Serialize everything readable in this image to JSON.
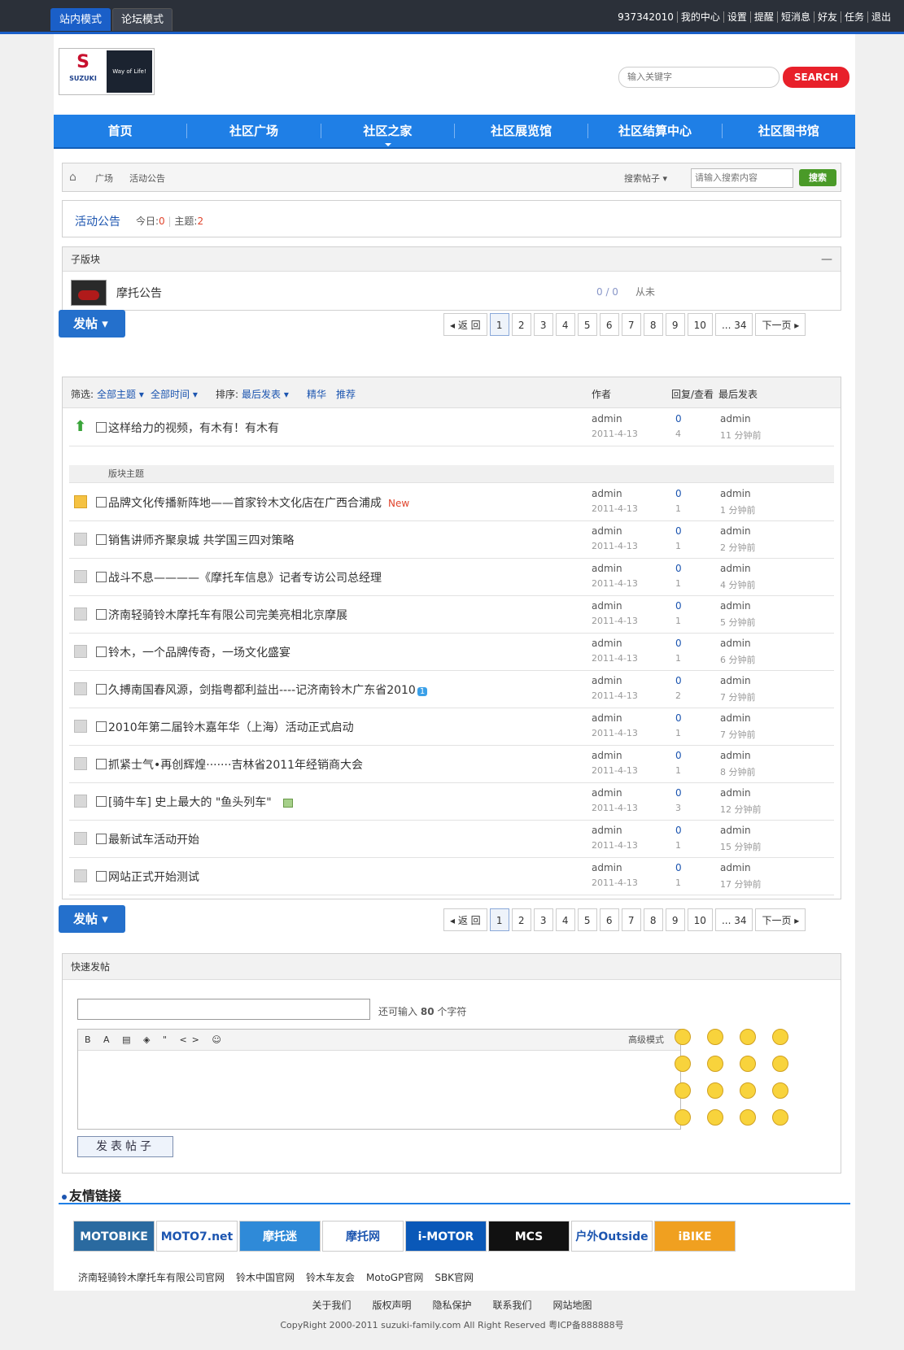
{
  "topbar": {
    "tabs": [
      "站内模式",
      "论坛模式"
    ],
    "links": [
      "937342010",
      "我的中心",
      "设置",
      "提醒",
      "短消息",
      "好友",
      "任务",
      "退出"
    ]
  },
  "header": {
    "logo_brand": "SUZUKI",
    "logo_slogan": "Way of Life!",
    "search_placeholder": "输入关键字",
    "search_button": "SEARCH"
  },
  "nav": [
    "首页",
    "社区广场",
    "社区之家",
    "社区展览馆",
    "社区结算中心",
    "社区图书馆"
  ],
  "breadcrumb": {
    "items": [
      "广场",
      "活动公告"
    ],
    "search_type": "搜索帖子 ▾",
    "search_placeholder": "请输入搜索内容",
    "search_button": "搜索"
  },
  "forum": {
    "name": "活动公告",
    "today_label": "今日:",
    "today": "0",
    "topics_label": "主题:",
    "topics": "2"
  },
  "subforum": {
    "header": "子版块",
    "collapse": "—",
    "name": "摩托公告",
    "counts": "0 / 0",
    "last": "从未"
  },
  "post_button": "发帖 ▾",
  "pager": [
    "◂ 返 回",
    "1",
    "2",
    "3",
    "4",
    "5",
    "6",
    "7",
    "8",
    "9",
    "10",
    "... 34",
    "下一页 ▸"
  ],
  "thread_header": {
    "filter_label": "筛选:",
    "filter_all": "全部主题 ▾",
    "filter_time": "全部时间 ▾",
    "sort_label": "排序:",
    "sort_value": "最后发表 ▾",
    "digest": "精华",
    "recommend": "推荐",
    "col_author": "作者",
    "col_reply": "回复/查看",
    "col_last": "最后发表"
  },
  "sticky": {
    "title": "这样给力的视频，有木有！有木有",
    "author": "admin",
    "date": "2011-4-13",
    "replies": "0",
    "views": "4",
    "last_user": "admin",
    "last_time": "11 分钟前"
  },
  "section_label": "版块主题",
  "threads": [
    {
      "title": "品牌文化传播新阵地——首家铃木文化店在广西合浦成",
      "new": "New",
      "author": "admin",
      "date": "2011-4-13",
      "replies": "0",
      "views": "1",
      "last_user": "admin",
      "last_time": "1 分钟前"
    },
    {
      "title": "销售讲师齐聚泉城  共学国三四对策略",
      "author": "admin",
      "date": "2011-4-13",
      "replies": "0",
      "views": "1",
      "last_user": "admin",
      "last_time": "2 分钟前"
    },
    {
      "title": "战斗不息————《摩托车信息》记者专访公司总经理",
      "author": "admin",
      "date": "2011-4-13",
      "replies": "0",
      "views": "1",
      "last_user": "admin",
      "last_time": "4 分钟前"
    },
    {
      "title": "济南轻骑铃木摩托车有限公司完美亮相北京摩展",
      "author": "admin",
      "date": "2011-4-13",
      "replies": "0",
      "views": "1",
      "last_user": "admin",
      "last_time": "5 分钟前"
    },
    {
      "title": "铃木，一个品牌传奇，一场文化盛宴",
      "author": "admin",
      "date": "2011-4-13",
      "replies": "0",
      "views": "1",
      "last_user": "admin",
      "last_time": "6 分钟前"
    },
    {
      "title": "久搏南国春风源，剑指粤都利益出----记济南铃木广东省2010",
      "tag": "1",
      "author": "admin",
      "date": "2011-4-13",
      "replies": "0",
      "views": "2",
      "last_user": "admin",
      "last_time": "7 分钟前"
    },
    {
      "title": "2010年第二届铃木嘉年华（上海）活动正式启动",
      "author": "admin",
      "date": "2011-4-13",
      "replies": "0",
      "views": "1",
      "last_user": "admin",
      "last_time": "7 分钟前"
    },
    {
      "title": "抓紧士气•再创辉煌·······吉林省2011年经销商大会",
      "author": "admin",
      "date": "2011-4-13",
      "replies": "0",
      "views": "1",
      "last_user": "admin",
      "last_time": "8 分钟前"
    },
    {
      "title": "[骑牛车] 史上最大的 \"鱼头列车\"",
      "img": true,
      "author": "admin",
      "date": "2011-4-13",
      "replies": "0",
      "views": "3",
      "last_user": "admin",
      "last_time": "12 分钟前"
    },
    {
      "title": "最新试车活动开始",
      "author": "admin",
      "date": "2011-4-13",
      "replies": "0",
      "views": "1",
      "last_user": "admin",
      "last_time": "15 分钟前"
    },
    {
      "title": "网站正式开始测试",
      "author": "admin",
      "date": "2011-4-13",
      "replies": "0",
      "views": "1",
      "last_user": "admin",
      "last_time": "17 分钟前"
    }
  ],
  "quick_post": {
    "header": "快速发帖",
    "remain_a": "还可输入",
    "remain_n": "80",
    "remain_b": "个字符",
    "toolbar": "B A ▤ ◈ \" <> ☺",
    "advanced": "高级模式",
    "submit": "发表帖子"
  },
  "friend_links": {
    "title": "友情链接",
    "logos": [
      "MOTOBIKE",
      "MOTO7.net",
      "摩托迷",
      "摩托网",
      "i-MOTOR",
      "MCS",
      "户外Outside",
      "iBIKE"
    ],
    "logo_colors": [
      "#2a6aa0",
      "#ffffff",
      "#2f8ad8",
      "#ffffff",
      "#0a58b8",
      "#111111",
      "#ffffff",
      "#f0a020"
    ],
    "text_links": [
      "济南轻骑铃木摩托车有限公司官网",
      "铃木中国官网",
      "铃木车友会",
      "MotoGP官网",
      "SBK官网"
    ]
  },
  "footer": {
    "links": [
      "关于我们",
      "版权声明",
      "隐私保护",
      "联系我们",
      "网站地图"
    ],
    "copyright": "CopyRight 2000-2011 suzuki-family.com All Right Reserved 粤ICP备888888号"
  }
}
